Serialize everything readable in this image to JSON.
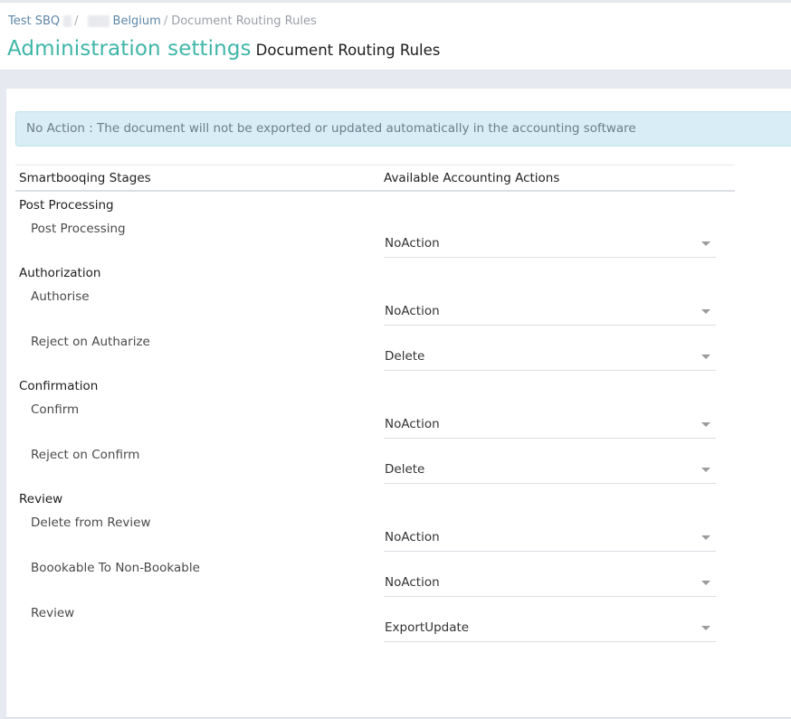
{
  "breadcrumb": {
    "items": [
      {
        "label": "Test SBQ",
        "link": true
      },
      {
        "label": "Belgium",
        "link": true
      },
      {
        "label": "Document Routing Rules",
        "link": false
      }
    ]
  },
  "header": {
    "title": "Administration settings",
    "subtitle": "Document Routing Rules"
  },
  "alert": {
    "text": "No Action : The document will not be exported or updated automatically in the accounting software"
  },
  "table": {
    "columns": [
      "Smartbooqing Stages",
      "Available Accounting Actions"
    ],
    "groups": [
      {
        "title": "Post Processing",
        "rows": [
          {
            "label": "Post Processing",
            "action": "NoAction"
          }
        ]
      },
      {
        "title": "Authorization",
        "rows": [
          {
            "label": "Authorise",
            "action": "NoAction"
          },
          {
            "label": "Reject on Autharize",
            "action": "Delete"
          }
        ]
      },
      {
        "title": "Confirmation",
        "rows": [
          {
            "label": "Confirm",
            "action": "NoAction"
          },
          {
            "label": "Reject on Confirm",
            "action": "Delete"
          }
        ]
      },
      {
        "title": "Review",
        "rows": [
          {
            "label": "Delete from Review",
            "action": "NoAction"
          },
          {
            "label": "Boookable To Non-Bookable",
            "action": "NoAction"
          },
          {
            "label": "Review",
            "action": "ExportUpdate"
          }
        ]
      }
    ]
  },
  "colors": {
    "accent": "#3fb6a8",
    "alert_bg": "#d9edf6",
    "link": "#5f87a8"
  }
}
